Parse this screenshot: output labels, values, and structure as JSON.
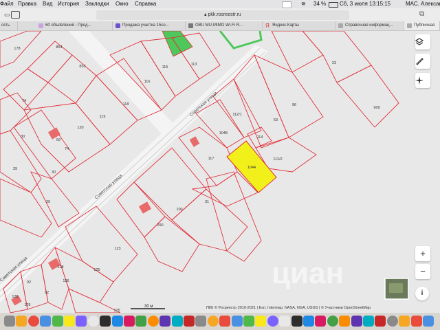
{
  "menubar": {
    "items": [
      "Файл",
      "Правка",
      "Вид",
      "История",
      "Закладки",
      "Окно",
      "Справка"
    ],
    "status": {
      "battery": "34 %",
      "datetime": "Сб, 3 июля  13:15:15",
      "user": "МАС. Александр"
    }
  },
  "browser": {
    "url": "pkk.rosreestr.ru",
    "tabs": [
      "ость",
      "60 объявлений - Прод...",
      "Продажа участка 15со...",
      "OBU MU-MIMO Wi-Fi R...",
      "Яндекс.Карты",
      "Справочная информац...",
      "Публичная"
    ]
  },
  "map": {
    "parcel_labels": [
      "178",
      "854",
      "853",
      "115",
      "113",
      "116",
      "118",
      "119",
      "120",
      "74",
      "74",
      "30",
      "29",
      "30",
      "29",
      "23",
      "909",
      "96",
      "53",
      "112/1",
      "104Б",
      "114",
      "112/2",
      "117",
      "1044",
      "100",
      "290",
      "31",
      "123",
      "125",
      "126",
      "92",
      "92",
      "128",
      "125",
      "59",
      "128",
      "125"
    ],
    "street_labels": [
      "Советская улица",
      "Советская улица",
      "Советская улица"
    ],
    "selected_parcel": "1044",
    "scale_label": "30 м",
    "attribution": "ПКК © Росреестр 2010-2021 | Esri, Intermap, NASA, NGA, USGS | © Участники OpenStreetMap",
    "watermark": "циан",
    "colors": {
      "parcel_border": "#e0303a",
      "selected_fill": "#f2f01a",
      "green_zone": "#4ec85a",
      "building": "#e86a6a"
    }
  },
  "controls": {
    "layers": "layers-icon",
    "ruler": "ruler-icon",
    "locate": "locate-icon",
    "zoom_in": "+",
    "zoom_out": "−",
    "info": "i"
  },
  "dock": {
    "app_count": 36
  }
}
